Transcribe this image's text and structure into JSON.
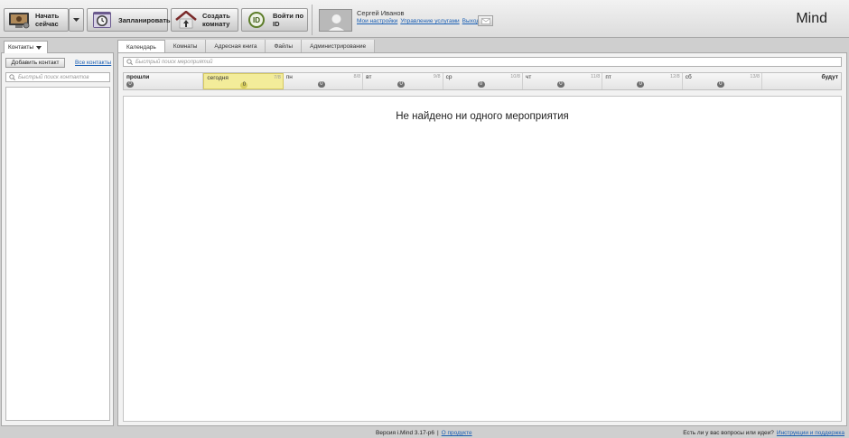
{
  "toolbar": {
    "start_label_1": "Начать",
    "start_label_2": "сейчас",
    "plan_label": "Запланировать",
    "room_label_1": "Создать",
    "room_label_2": "комнату",
    "byid_label": "Войти по ID",
    "byid_icon_text": "ID"
  },
  "user": {
    "name": "Сергей Иванов",
    "links": [
      "Мои настройки",
      "Управление услугами",
      "Выход"
    ]
  },
  "logo": "Mind",
  "left_panel": {
    "tab_label": "Контакты",
    "add_contact": "Добавить контакт",
    "all_contacts": "Все контакты",
    "search_placeholder": "Быстрый поиск контактов"
  },
  "main_tabs": [
    "Календарь",
    "Комнаты",
    "Адресная книга",
    "Файлы",
    "Администрирование"
  ],
  "calendar": {
    "search_placeholder": "Быстрый поиск мероприятий",
    "days": [
      {
        "name": "прошли",
        "date": "",
        "count": "0"
      },
      {
        "name": "сегодня",
        "date": "7/8",
        "count": "0"
      },
      {
        "name": "пн",
        "date": "8/8",
        "count": "0"
      },
      {
        "name": "вт",
        "date": "9/8",
        "count": "0"
      },
      {
        "name": "ср",
        "date": "10/8",
        "count": "0"
      },
      {
        "name": "чт",
        "date": "11/8",
        "count": "0"
      },
      {
        "name": "пт",
        "date": "12/8",
        "count": "0"
      },
      {
        "name": "сб",
        "date": "13/8",
        "count": "0"
      },
      {
        "name": "будут",
        "date": "",
        "count": ""
      }
    ],
    "empty_message": "Не найдено ни одного мероприятия"
  },
  "footer": {
    "version": "Версия i.Mind 3.17-p6",
    "separator": "|",
    "about": "О продукте",
    "question": "Есть ли у вас вопросы или идеи?",
    "support": "Инструкции и поддержка"
  },
  "colors": {
    "today_bg": "#f3ec9a",
    "link": "#1a5fb4"
  }
}
